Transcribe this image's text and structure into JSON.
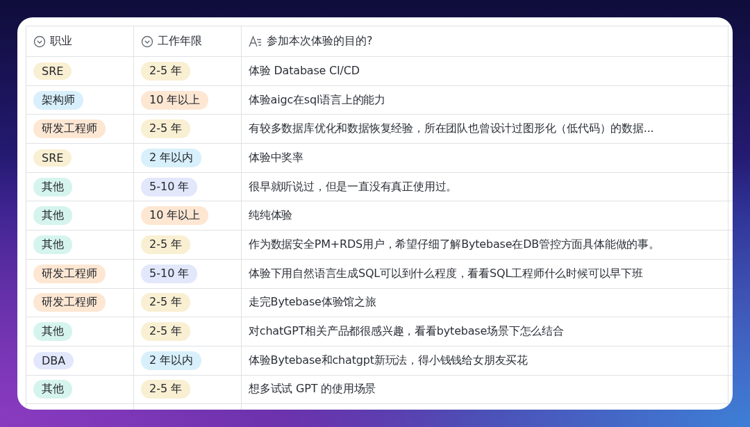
{
  "table": {
    "columns": [
      {
        "label": "职业",
        "kind": "select"
      },
      {
        "label": "工作年限",
        "kind": "select"
      },
      {
        "label": "参加本次体验的目的?",
        "kind": "text"
      }
    ],
    "rows": [
      {
        "role": {
          "text": "SRE",
          "color": "#f9efd2"
        },
        "years": {
          "text": "2-5 年",
          "color": "#f9efd2"
        },
        "purpose": "体验 Database CI/CD"
      },
      {
        "role": {
          "text": "架构师",
          "color": "#d8f0fb"
        },
        "years": {
          "text": "10 年以上",
          "color": "#fde7d3"
        },
        "purpose": "体验aigc在sql语言上的能力"
      },
      {
        "role": {
          "text": "研发工程师",
          "color": "#fde7d3"
        },
        "years": {
          "text": "2-5 年",
          "color": "#f9efd2"
        },
        "purpose": "有较多数据库优化和数据恢复经验，所在团队也曾设计过图形化（低代码）的数据..."
      },
      {
        "role": {
          "text": "SRE",
          "color": "#f9efd2"
        },
        "years": {
          "text": "2 年以内",
          "color": "#d8f0fb"
        },
        "purpose": "体验中奖率"
      },
      {
        "role": {
          "text": "其他",
          "color": "#d6f4ee"
        },
        "years": {
          "text": "5-10 年",
          "color": "#e2e7fb"
        },
        "purpose": "很早就听说过，但是一直没有真正使用过。"
      },
      {
        "role": {
          "text": "其他",
          "color": "#d6f4ee"
        },
        "years": {
          "text": "10 年以上",
          "color": "#fde7d3"
        },
        "purpose": "纯纯体验"
      },
      {
        "role": {
          "text": "其他",
          "color": "#d6f4ee"
        },
        "years": {
          "text": "2-5 年",
          "color": "#f9efd2"
        },
        "purpose": "作为数据安全PM+RDS用户，希望仔细了解Bytebase在DB管控方面具体能做的事。"
      },
      {
        "role": {
          "text": "研发工程师",
          "color": "#fde7d3"
        },
        "years": {
          "text": "5-10 年",
          "color": "#e2e7fb"
        },
        "purpose": "体验下用自然语言生成SQL可以到什么程度，看看SQL工程师什么时候可以早下班"
      },
      {
        "role": {
          "text": "研发工程师",
          "color": "#fde7d3"
        },
        "years": {
          "text": "2-5 年",
          "color": "#f9efd2"
        },
        "purpose": "走完Bytebase体验馆之旅"
      },
      {
        "role": {
          "text": "其他",
          "color": "#d6f4ee"
        },
        "years": {
          "text": "2-5 年",
          "color": "#f9efd2"
        },
        "purpose": "对chatGPT相关产品都很感兴趣，看看bytebase场景下怎么结合"
      },
      {
        "role": {
          "text": "DBA",
          "color": "#e2e7fb"
        },
        "years": {
          "text": "2 年以内",
          "color": "#d8f0fb"
        },
        "purpose": "体验Bytebase和chatgpt新玩法，得小钱钱给女朋友买花"
      },
      {
        "role": {
          "text": "其他",
          "color": "#d6f4ee"
        },
        "years": {
          "text": "2-5 年",
          "color": "#f9efd2"
        },
        "purpose": "想多试试 GPT 的使用场景"
      }
    ]
  }
}
